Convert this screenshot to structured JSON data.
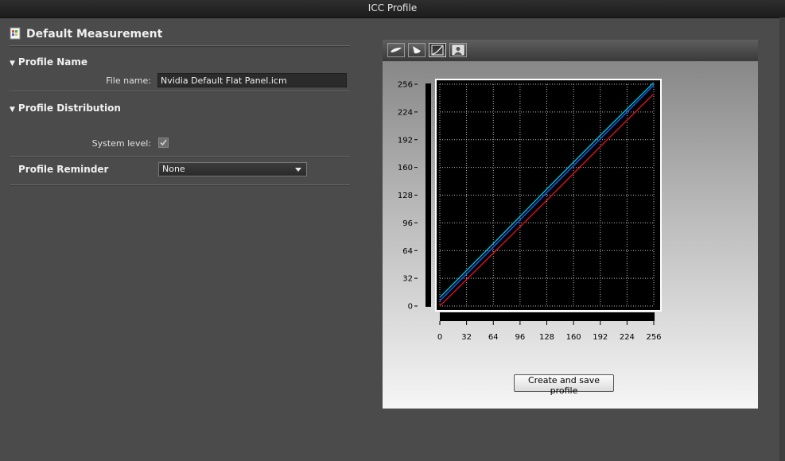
{
  "window": {
    "title": "ICC Profile"
  },
  "left": {
    "title": "Default Measurement",
    "profile_name": {
      "header": "Profile Name",
      "file_label": "File name:",
      "file_value": "Nvidia Default Flat Panel.icm"
    },
    "distribution": {
      "header": "Profile Distribution",
      "system_label": "System level:",
      "system_checked": true
    },
    "reminder": {
      "label": "Profile Reminder",
      "selected": "None"
    }
  },
  "toolbar": {
    "buttons": [
      {
        "icon": "gamut-icon",
        "active": false
      },
      {
        "icon": "cone-icon",
        "active": false
      },
      {
        "icon": "curve-icon",
        "active": true
      },
      {
        "icon": "image-icon",
        "active": false
      }
    ]
  },
  "chart_data": {
    "type": "line",
    "title": "",
    "xlabel": "",
    "ylabel": "",
    "xlim": [
      0,
      256
    ],
    "ylim": [
      0,
      256
    ],
    "x_ticks": [
      0,
      32,
      64,
      96,
      128,
      160,
      192,
      224,
      256
    ],
    "y_ticks": [
      0,
      32,
      64,
      96,
      128,
      160,
      192,
      224,
      256
    ],
    "grid": true,
    "series": [
      {
        "color": "#00c0d0",
        "x": [
          0,
          64,
          128,
          192,
          256
        ],
        "y": [
          10,
          72,
          135,
          197,
          258
        ]
      },
      {
        "color": "#1060ff",
        "x": [
          0,
          64,
          128,
          192,
          256
        ],
        "y": [
          6,
          68,
          131,
          193,
          255
        ]
      },
      {
        "color": "#e01020",
        "x": [
          0,
          64,
          128,
          192,
          256
        ],
        "y": [
          0,
          61,
          122,
          184,
          245
        ]
      }
    ]
  },
  "actions": {
    "save_label": "Create and save profile"
  }
}
